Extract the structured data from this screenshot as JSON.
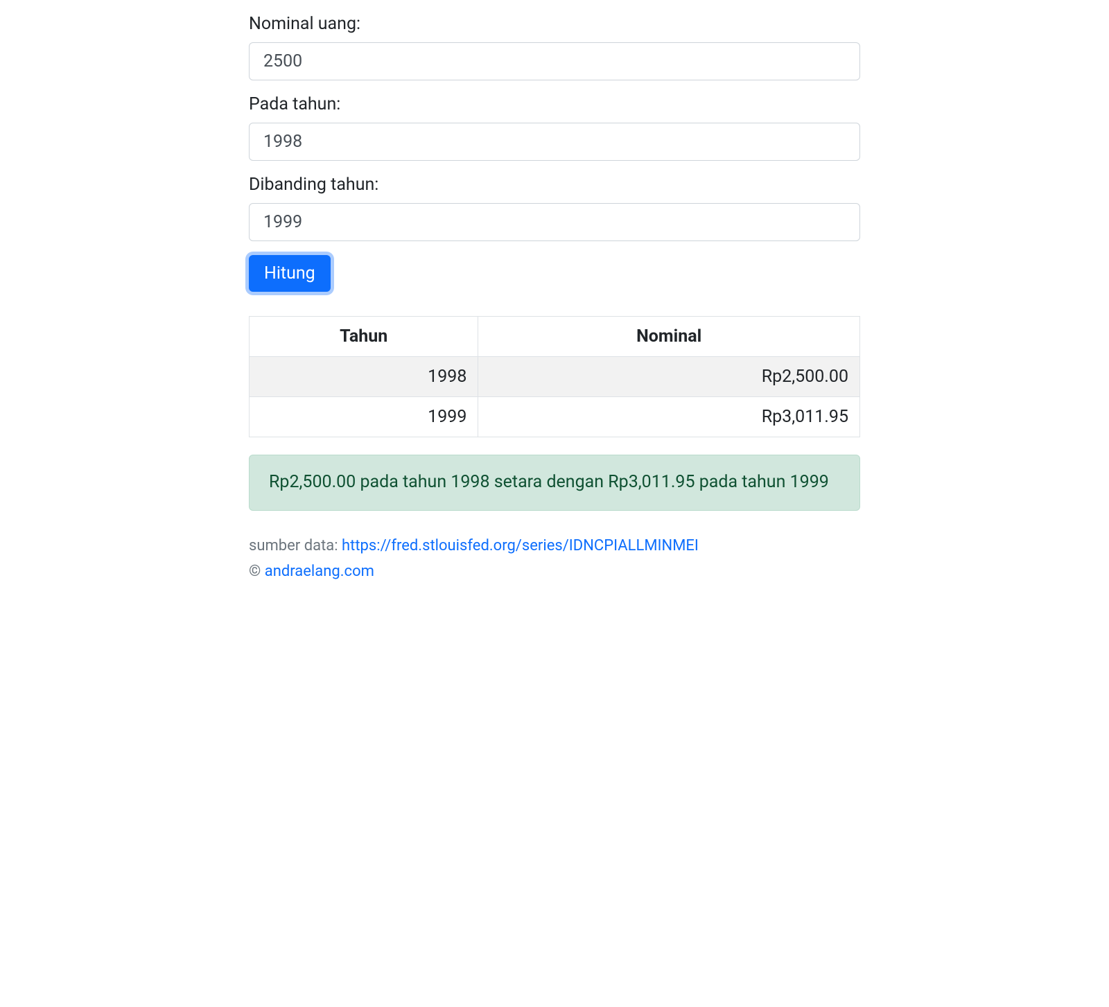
{
  "form": {
    "nominal_label": "Nominal uang:",
    "nominal_value": "2500",
    "year_from_label": "Pada tahun:",
    "year_from_value": "1998",
    "year_to_label": "Dibanding tahun:",
    "year_to_value": "1999",
    "submit_label": "Hitung"
  },
  "table": {
    "header_tahun": "Tahun",
    "header_nominal": "Nominal",
    "rows": [
      {
        "tahun": "1998",
        "nominal": "Rp2,500.00"
      },
      {
        "tahun": "1999",
        "nominal": "Rp3,011.95"
      }
    ]
  },
  "result_message": "Rp2,500.00 pada tahun 1998 setara dengan Rp3,011.95 pada tahun 1999",
  "footer": {
    "source_prefix": "sumber data: ",
    "source_link": "https://fred.stlouisfed.org/series/IDNCPIALLMINMEI",
    "copyright_prefix": "© ",
    "copyright_link": "andraelang.com"
  }
}
